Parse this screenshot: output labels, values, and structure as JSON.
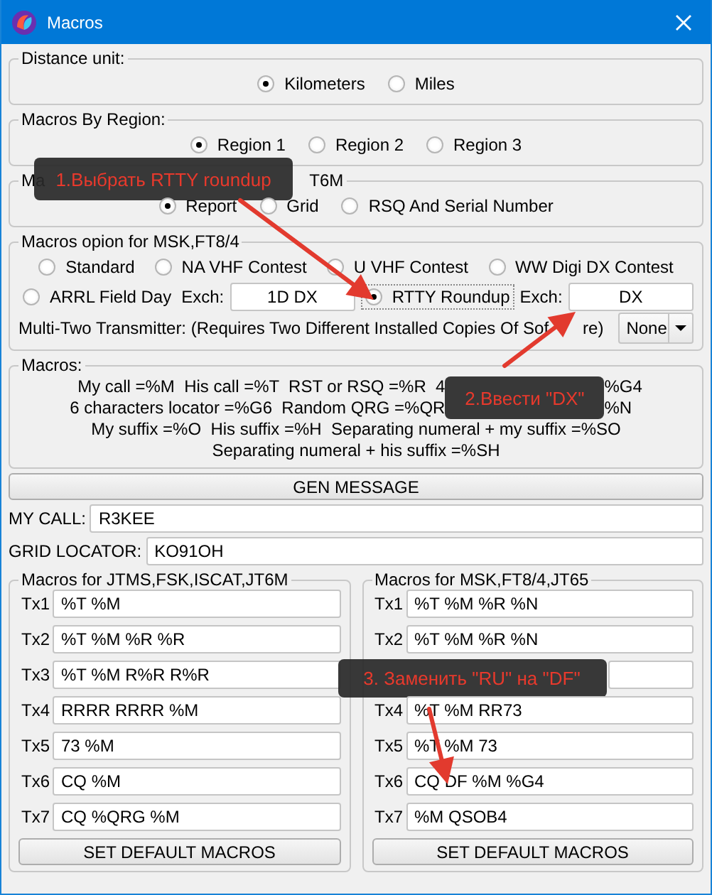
{
  "window": {
    "title": "Macros"
  },
  "distance_unit": {
    "label": "Distance unit:",
    "options": [
      {
        "label": "Kilometers",
        "selected": true
      },
      {
        "label": "Miles",
        "selected": false
      }
    ]
  },
  "region": {
    "label": "Macros By Region:",
    "options": [
      {
        "label": "Region 1",
        "selected": true
      },
      {
        "label": "Region 2",
        "selected": false
      },
      {
        "label": "Region 3",
        "selected": false
      }
    ]
  },
  "report_format": {
    "label_start": "Ma",
    "label_end": "T6M",
    "callout": "1.Выбрать RTTY roundup",
    "options": [
      {
        "label": "Report",
        "selected": true
      },
      {
        "label": "Grid",
        "selected": false
      },
      {
        "label": "RSQ And Serial Number",
        "selected": false
      }
    ]
  },
  "msk_options": {
    "label": "Macros opion for MSK,FT8/4",
    "contest_line": [
      {
        "kind": "radio",
        "label": "Standard",
        "selected": false
      },
      {
        "kind": "radio",
        "label": "NA VHF Contest",
        "selected": false
      },
      {
        "kind": "radio",
        "label": "U VHF Contest",
        "selected": false
      },
      {
        "kind": "radio",
        "label": "WW Digi DX Contest",
        "selected": false
      }
    ],
    "exchange_line": [
      {
        "kind": "radio",
        "label": "ARRL Field Day",
        "selected": false
      },
      {
        "kind": "label",
        "label": "Exch:"
      },
      {
        "kind": "field",
        "value": "1D DX"
      },
      {
        "kind": "radio",
        "label": "RTTY Roundup",
        "selected": true,
        "focused": true
      },
      {
        "kind": "label",
        "label": "Exch:"
      },
      {
        "kind": "field",
        "value": "DX"
      }
    ],
    "transmitter_line": [
      {
        "kind": "label",
        "label": "Multi-Two Transmitter: (Requires Two Different Installed Copies Of Sof"
      },
      {
        "kind": "gap"
      },
      {
        "kind": "label",
        "label": "re)"
      },
      {
        "kind": "combo",
        "value": "None"
      }
    ]
  },
  "macros_help": {
    "label": "Macros:",
    "callout": "2.Ввести \"DX\"",
    "split_lines": [
      {
        "start": "My call =%M  His call =%T  RST or RSQ =%R  4",
        "end": "%G4"
      },
      {
        "start": "6 characters locator =%G6  Random QRG =%QR",
        "end": "%N"
      }
    ],
    "lines": [
      "My suffix =%O  His suffix =%H  Separating numeral + my suffix =%SO",
      "Separating numeral + his suffix =%SH"
    ]
  },
  "gen_button": "GEN MESSAGE",
  "my_call": {
    "label": "MY CALL:",
    "value": "R3KEE"
  },
  "grid_locator": {
    "label": "GRID LOCATOR:",
    "value": "KO91OH"
  },
  "macro_sets": [
    {
      "label": "Macros for JTMS,FSK,ISCAT,JT6M",
      "button": "SET DEFAULT MACROS",
      "rows": [
        {
          "kind": "entry",
          "label": "Tx1",
          "value": "%T %M"
        },
        {
          "kind": "entry",
          "label": "Tx2",
          "value": "%T %M %R %R"
        },
        {
          "kind": "entry",
          "label": "Tx3",
          "value": "%T %M R%R R%R"
        },
        {
          "kind": "entry",
          "label": "Tx4",
          "value": "RRRR RRRR %M"
        },
        {
          "kind": "entry",
          "label": "Tx5",
          "value": "73 %M"
        },
        {
          "kind": "entry",
          "label": "Tx6",
          "value": "CQ %M"
        },
        {
          "kind": "entry",
          "label": "Tx7",
          "value": "CQ %QRG %M"
        }
      ]
    },
    {
      "label": "Macros for MSK,FT8/4,JT65",
      "button": "SET DEFAULT MACROS",
      "rows": [
        {
          "kind": "entry",
          "label": "Tx1",
          "value": "%T %M %R %N"
        },
        {
          "kind": "entry",
          "label": "Tx2",
          "value": "%T %M %R %N"
        },
        {
          "kind": "callout",
          "text": "3. Заменить \"RU\" на \"DF\""
        },
        {
          "kind": "entry",
          "label": "Tx4",
          "value": "%T %M RR73"
        },
        {
          "kind": "entry",
          "label": "Tx5",
          "value": "%T %M 73"
        },
        {
          "kind": "entry",
          "label": "Tx6",
          "value": "CQ DF %M %G4"
        },
        {
          "kind": "entry",
          "label": "Tx7",
          "value": "%M QSOB4"
        }
      ]
    }
  ]
}
